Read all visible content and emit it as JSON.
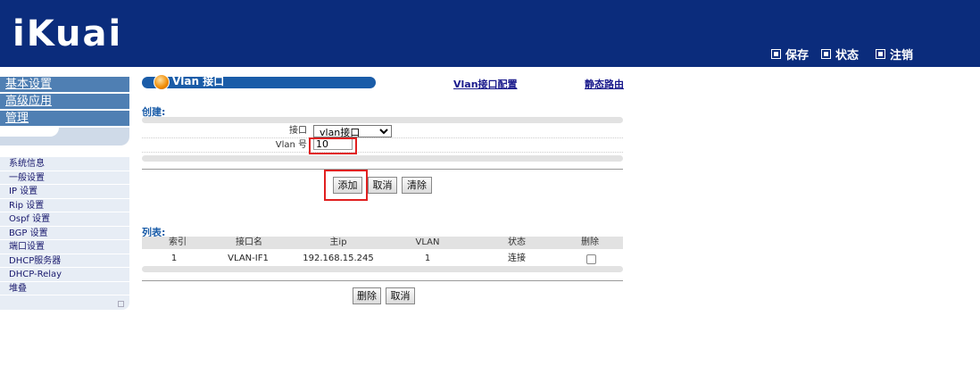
{
  "header": {
    "logo": "iKuai",
    "nav": [
      {
        "label": "保存"
      },
      {
        "label": "状态"
      },
      {
        "label": "注销"
      }
    ]
  },
  "sidebar": {
    "main": [
      "基本设置",
      "高级应用",
      "管理"
    ],
    "items": [
      "系统信息",
      "一般设置",
      "IP 设置",
      "Rip 设置",
      "Ospf 设置",
      "BGP 设置",
      "端口设置",
      "DHCP服务器",
      "DHCP-Relay",
      "堆叠"
    ]
  },
  "content": {
    "title": "Vlan 接口",
    "links": {
      "vlan_config": "Vlan接口配置",
      "static_route": "静态路由"
    },
    "create_label": "创建:",
    "form": {
      "interface_label": "接口",
      "interface_value": "vlan接口",
      "vlan_label": "Vlan 号",
      "vlan_value": "10"
    },
    "buttons": {
      "add": "添加",
      "cancel": "取消",
      "clear": "清除",
      "delete": "删除",
      "cancel2": "取消"
    },
    "list_label": "列表:",
    "table": {
      "headers": [
        "索引",
        "接口名",
        "主ip",
        "VLAN",
        "状态",
        "删除"
      ],
      "rows": [
        {
          "index": "1",
          "name": "VLAN-IF1",
          "ip": "192.168.15.245",
          "vlan": "1",
          "status": "连接",
          "delete": false
        }
      ]
    }
  }
}
